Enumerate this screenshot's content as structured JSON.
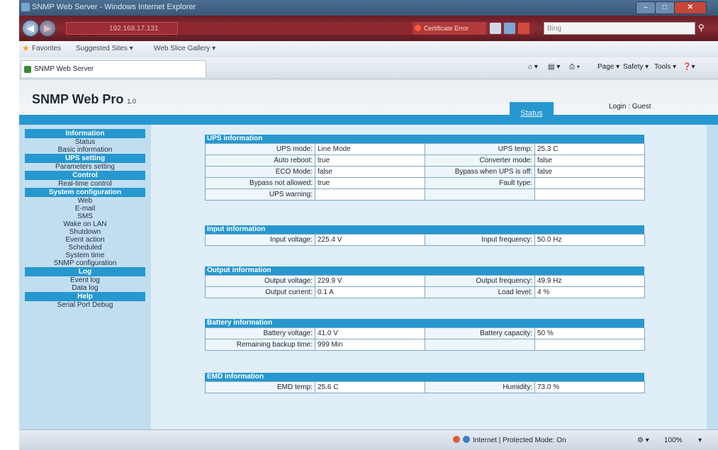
{
  "browser": {
    "window_title": "SNMP Web Server - Windows Internet Explorer",
    "url": "192.168.17.131",
    "cert_error": "Certificate Error",
    "search_placeholder": "Bing",
    "favorites": {
      "label": "Favorites",
      "items": [
        "Suggested Sites ▾",
        "Web Slice Gallery ▾"
      ]
    },
    "tab_title": "SNMP Web Server",
    "commands": [
      "Page ▾",
      "Safety ▾",
      "Tools ▾"
    ],
    "statusbar": {
      "zone": "Internet | Protected Mode: On",
      "zoom": "100%"
    }
  },
  "header": {
    "brand": "SNMP Web Pro",
    "version": "1.0",
    "active_tab": "Status",
    "login": "Login : Guest"
  },
  "sidebar": {
    "groups": [
      {
        "title": "Information",
        "items": [
          "Status",
          "Basic information"
        ]
      },
      {
        "title": "UPS setting",
        "items": [
          "Parameters setting"
        ]
      },
      {
        "title": "Control",
        "items": [
          "Real-time control"
        ]
      },
      {
        "title": "System configuration",
        "items": [
          "Web",
          "E-mail",
          "SMS",
          "Wake on LAN",
          "Shutdown",
          "Event action",
          "Scheduled",
          "System time",
          "SNMP configuration"
        ]
      },
      {
        "title": "Log",
        "items": [
          "Event log",
          "Data log"
        ]
      },
      {
        "title": "Help",
        "items": [
          "Serial Port Debug"
        ]
      }
    ]
  },
  "sections": {
    "ups": {
      "title": "UPS information",
      "rows": [
        [
          "UPS mode:",
          "Line Mode",
          "UPS temp:",
          "25.3 C"
        ],
        [
          "Auto reboot:",
          "true",
          "Converter mode:",
          "false"
        ],
        [
          "ECO Mode:",
          "false",
          "Bypass when UPS is off:",
          "false"
        ],
        [
          "Bypass not allowed:",
          "true",
          "Fault type:",
          ""
        ],
        [
          "UPS warning:",
          "",
          "",
          ""
        ]
      ]
    },
    "input": {
      "title": "Input information",
      "rows": [
        [
          "Input voltage:",
          "225.4 V",
          "Input frequency:",
          "50.0 Hz"
        ]
      ]
    },
    "output": {
      "title": "Output information",
      "rows": [
        [
          "Output voltage:",
          "229.9 V",
          "Output frequency:",
          "49.9 Hz"
        ],
        [
          "Output current:",
          "0.1 A",
          "Load level:",
          "4 %"
        ]
      ]
    },
    "battery": {
      "title": "Battery information",
      "rows": [
        [
          "Battery voltage:",
          "41.0 V",
          "Battery capacity:",
          "50 %"
        ],
        [
          "Remaining backup time:",
          "999 Min",
          "",
          ""
        ]
      ]
    },
    "emd": {
      "title": "EMD information",
      "rows": [
        [
          "EMD temp:",
          "25.6 C",
          "Humidity:",
          "73.0 %"
        ]
      ]
    }
  }
}
